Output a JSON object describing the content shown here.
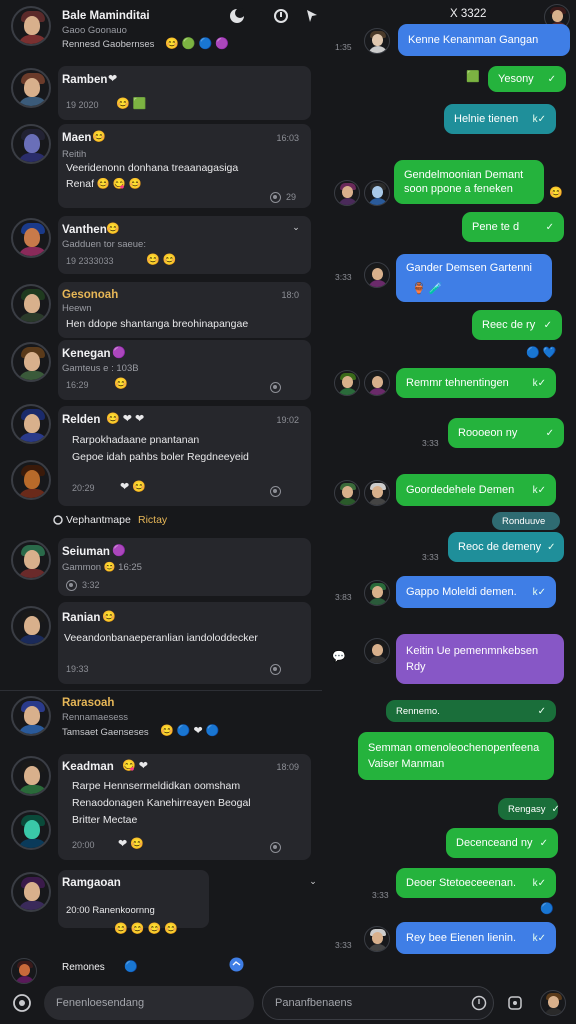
{
  "colors": {
    "bg": "#17181b",
    "card": "#26272c",
    "green": "#25b33d",
    "blue": "#3f7ee6",
    "teal": "#1f8f9a",
    "purple": "#8757c6"
  },
  "left_header": {
    "title": "Bale Maminditai",
    "subtitle": "Gaoo Goonauo",
    "sub2": "Rennesd Gaobernses"
  },
  "top_right": {
    "title": "X 3322"
  },
  "left_icons": [
    "moon-icon",
    "refresh-icon",
    "pin-icon"
  ],
  "conversations": [
    {
      "name": "Ramben",
      "emoji": "❤",
      "line1": "",
      "line2": "",
      "time": "19 2020",
      "extra": "😊 🟩"
    },
    {
      "name": "Maen",
      "emoji": "😊",
      "sub": "Reitih",
      "line1": "Veeridenonn donhana treaanagasiga",
      "line2": "Renaf 😊 😋 😊",
      "time": "16:03"
    },
    {
      "name": "Vanthen",
      "emoji": "😊",
      "sub": "Gadduen tor saeue:",
      "time": "19 2333033",
      "extra": "😊 😊"
    },
    {
      "name": "Gesonoah",
      "sub": "Heewn",
      "line1": "Hen ddope shantanga breohinapangae",
      "time": "18:0"
    },
    {
      "name": "Kenegan",
      "emoji": "🟣",
      "sub": "Gamteus e : 103B",
      "time": "16:29",
      "extra": "😊"
    },
    {
      "name": "Relden",
      "emoji": "😊 ❤ ❤",
      "line1": "Rarpokhadaane pnantanan",
      "line2": "Gepoe idah pahbs boler Regdneeyeid",
      "time": "20:29",
      "extra": "❤ 😊",
      "right_time": "19:02"
    },
    {
      "name": "Seiuman",
      "emoji": "🟣",
      "sub": "Gammon 😊 16:25",
      "time": "3:32"
    },
    {
      "name": "Ranian",
      "emoji": "😊",
      "line1": "Veeandonbanaeperanlian iandoloddecker",
      "time": "19:33"
    },
    {
      "name": "Keadman",
      "emoji": "😋 ❤",
      "line1": "Rarpe Hennsermeldidkan oomsham",
      "line2": "Renaodonagen Kanehirreayen Beogal",
      "line3": "Britter Mectae",
      "time": "20:00",
      "extra": "❤ 😊"
    },
    {
      "name": "Ramgaoan",
      "sub": "20:00 Ranenkoornng",
      "extra": "😊 😊 😊 😊"
    },
    {
      "name": "Remones",
      "emoji": "🔵"
    }
  ],
  "section_divider": "Vephantmape",
  "section_divider_accent": "Rictay",
  "left_mid_header": {
    "title": "Rarasoah",
    "subtitle": "Rennamaesess",
    "sub2": "Tamsaet Gaenseses"
  },
  "left_input_placeholder": "Fenenloesendang",
  "right_input_placeholder": "Pananfbenaens",
  "bubbles": [
    {
      "text": "Kenne Kenanman Gangan",
      "type": "b"
    },
    {
      "text": "Yesony",
      "type": "g",
      "tick": "✓"
    },
    {
      "text": "Helnie tienen",
      "type": "t",
      "tick": "k✓"
    },
    {
      "text": "Gendelmoonian Demant soon ppone a feneken",
      "type": "g"
    },
    {
      "text": "Pene te d",
      "type": "g",
      "tick": "✓"
    },
    {
      "text": "Gander Demsen Gartenni",
      "type": "b"
    },
    {
      "text": "Reec de ry",
      "type": "g",
      "tick": "✓"
    },
    {
      "text": "Remmr tehnentingen",
      "type": "g",
      "tick": "k✓"
    },
    {
      "text": "Roooeon ny",
      "type": "g",
      "tick": "✓"
    },
    {
      "text": "Goordedehele Demen",
      "type": "g",
      "tick": "k✓"
    },
    {
      "text": "Ronduuve",
      "type": "tl"
    },
    {
      "text": "Reoc de demeny",
      "type": "t",
      "tick": "✓"
    },
    {
      "text": "Gappo Moleldi demen.",
      "type": "b",
      "tick": "k✓"
    },
    {
      "text": "Keitin Ue pemenmnkebsen Rdy",
      "type": "p"
    },
    {
      "text": "Rennemo.",
      "type": "d",
      "tick": "✓"
    },
    {
      "text": "Semman omenoleochenopenfeena Vaiser Manman",
      "type": "g"
    },
    {
      "text": "Rengasy",
      "type": "d",
      "tick": "✓"
    },
    {
      "text": "Decenceand ny",
      "type": "g",
      "tick": "✓"
    },
    {
      "text": "Deoer Stetoeceeenan.",
      "type": "g",
      "tick": "k✓"
    },
    {
      "text": "Rey bee Eienen lienin.",
      "type": "b",
      "tick": "k✓"
    }
  ],
  "right_times": [
    "1:35",
    "3:33",
    "3:33",
    "3:33",
    "3:83",
    "3:33",
    "3:33",
    "3:33"
  ]
}
